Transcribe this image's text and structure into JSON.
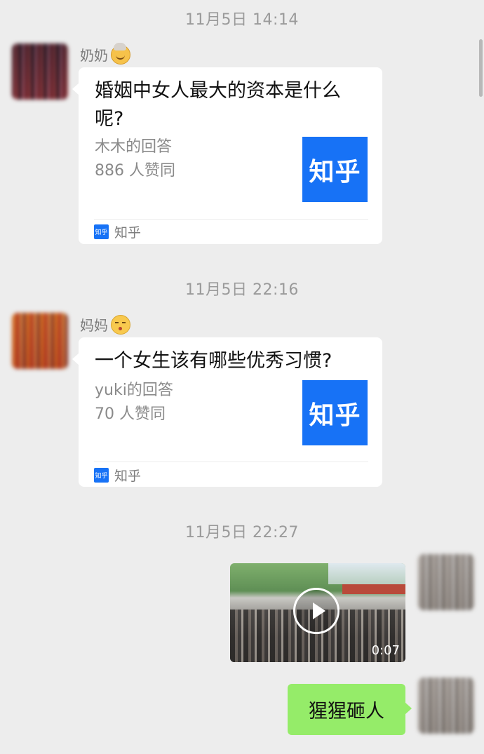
{
  "messages": [
    {
      "timestamp": "11月5日 14:14",
      "sender": "奶奶",
      "card": {
        "title": "婚姻中女人最大的资本是什么呢?",
        "answer_by": "木木的回答",
        "likes": "886 人赞同",
        "thumb_label": "知乎",
        "source_icon": "知乎",
        "source_label": "知乎"
      }
    },
    {
      "timestamp": "11月5日 22:16",
      "sender": "妈妈",
      "card": {
        "title": "一个女生该有哪些优秀习惯?",
        "answer_by": "yuki的回答",
        "likes": "70 人赞同",
        "thumb_label": "知乎",
        "source_icon": "知乎",
        "source_label": "知乎"
      }
    },
    {
      "timestamp": "11月5日 22:27",
      "video": {
        "duration": "0:07"
      },
      "text": "猩猩砸人"
    }
  ],
  "icons": {
    "granny_emoji": "older-woman-emoji-icon",
    "kiss_emoji": "kissing-face-emoji-icon",
    "play": "play-icon",
    "zhihu": "zhihu-logo-icon"
  },
  "colors": {
    "background": "#ededed",
    "card": "#ffffff",
    "sent_bubble": "#95ec69",
    "zhihu_blue": "#1772f6",
    "timestamp_text": "#9a9a9a"
  }
}
